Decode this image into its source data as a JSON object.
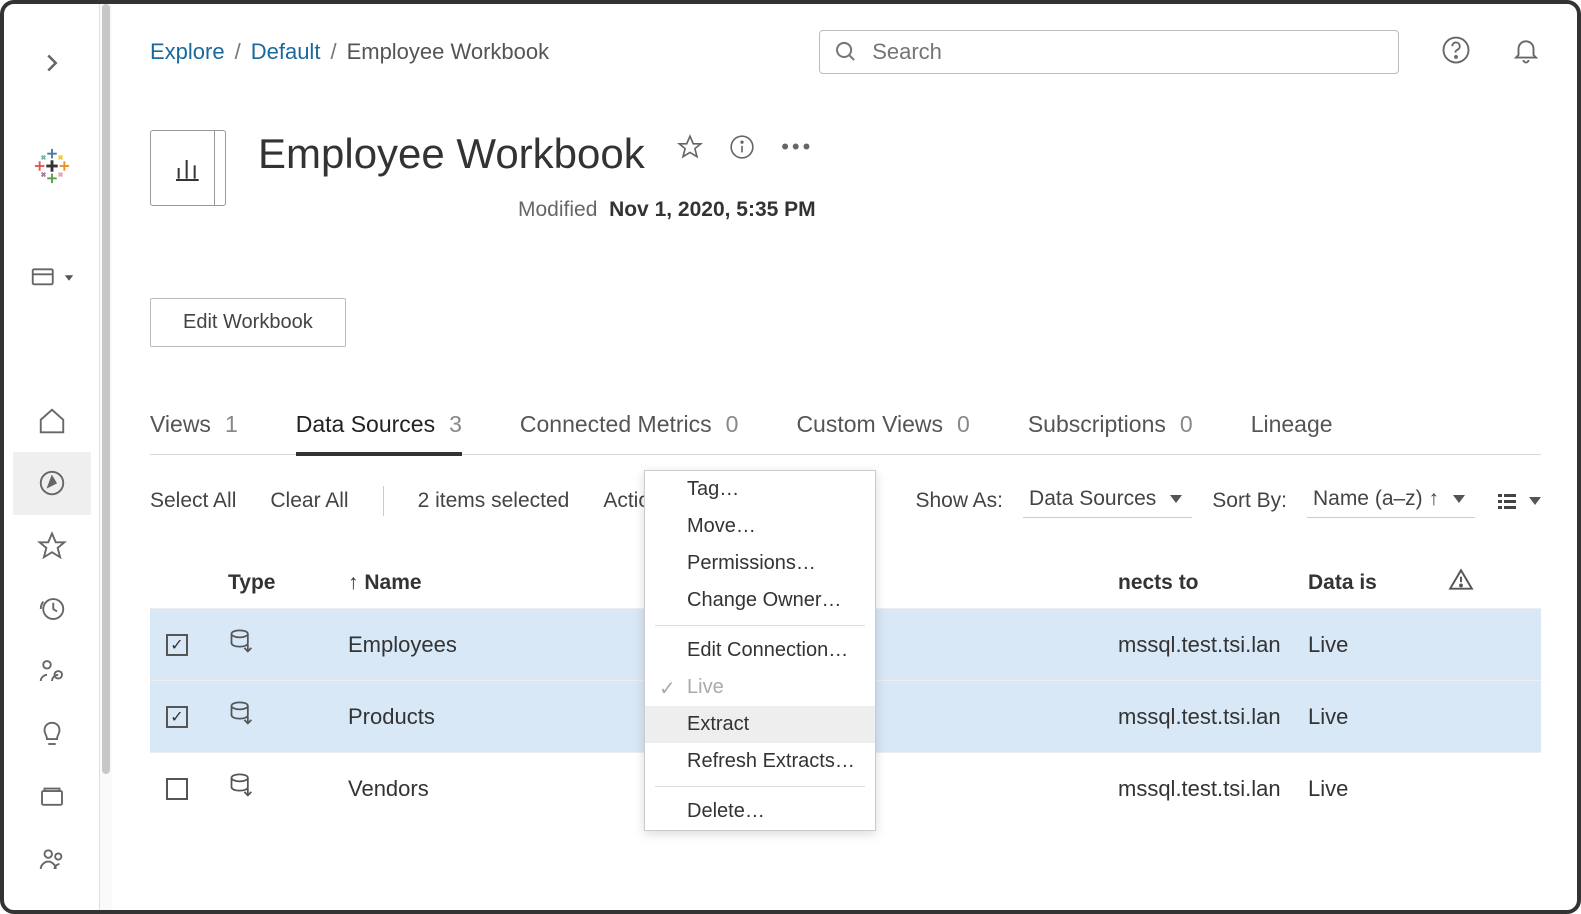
{
  "breadcrumb": {
    "root": "Explore",
    "parent": "Default",
    "current": "Employee Workbook"
  },
  "search": {
    "placeholder": "Search"
  },
  "header": {
    "title": "Employee Workbook",
    "modified_label": "Modified",
    "modified_value": "Nov 1, 2020, 5:35 PM",
    "edit_button": "Edit Workbook"
  },
  "tabs": [
    {
      "label": "Views",
      "count": "1"
    },
    {
      "label": "Data Sources",
      "count": "3"
    },
    {
      "label": "Connected Metrics",
      "count": "0"
    },
    {
      "label": "Custom Views",
      "count": "0"
    },
    {
      "label": "Subscriptions",
      "count": "0"
    },
    {
      "label": "Lineage",
      "count": ""
    }
  ],
  "toolbar": {
    "select_all": "Select All",
    "clear_all": "Clear All",
    "selection": "2 items selected",
    "actions": "Actions",
    "show_as_label": "Show As:",
    "show_as_value": "Data Sources",
    "sort_by_label": "Sort By:",
    "sort_by_value": "Name (a–z) ↑"
  },
  "columns": {
    "type": "Type",
    "name": "Name",
    "connects_to": "nects to",
    "data_is": "Data is"
  },
  "rows": [
    {
      "name": "Employees",
      "connects_to": "mssql.test.tsi.lan",
      "data_is": "Live",
      "selected": true
    },
    {
      "name": "Products",
      "connects_to": "mssql.test.tsi.lan",
      "data_is": "Live",
      "selected": true
    },
    {
      "name": "Vendors",
      "connects_to": "mssql.test.tsi.lan",
      "data_is": "Live",
      "selected": false
    }
  ],
  "dropdown": {
    "tag": "Tag…",
    "move": "Move…",
    "permissions": "Permissions…",
    "change_owner": "Change Owner…",
    "edit_connection": "Edit Connection…",
    "live": "Live",
    "extract": "Extract",
    "refresh": "Refresh Extracts…",
    "delete": "Delete…"
  }
}
